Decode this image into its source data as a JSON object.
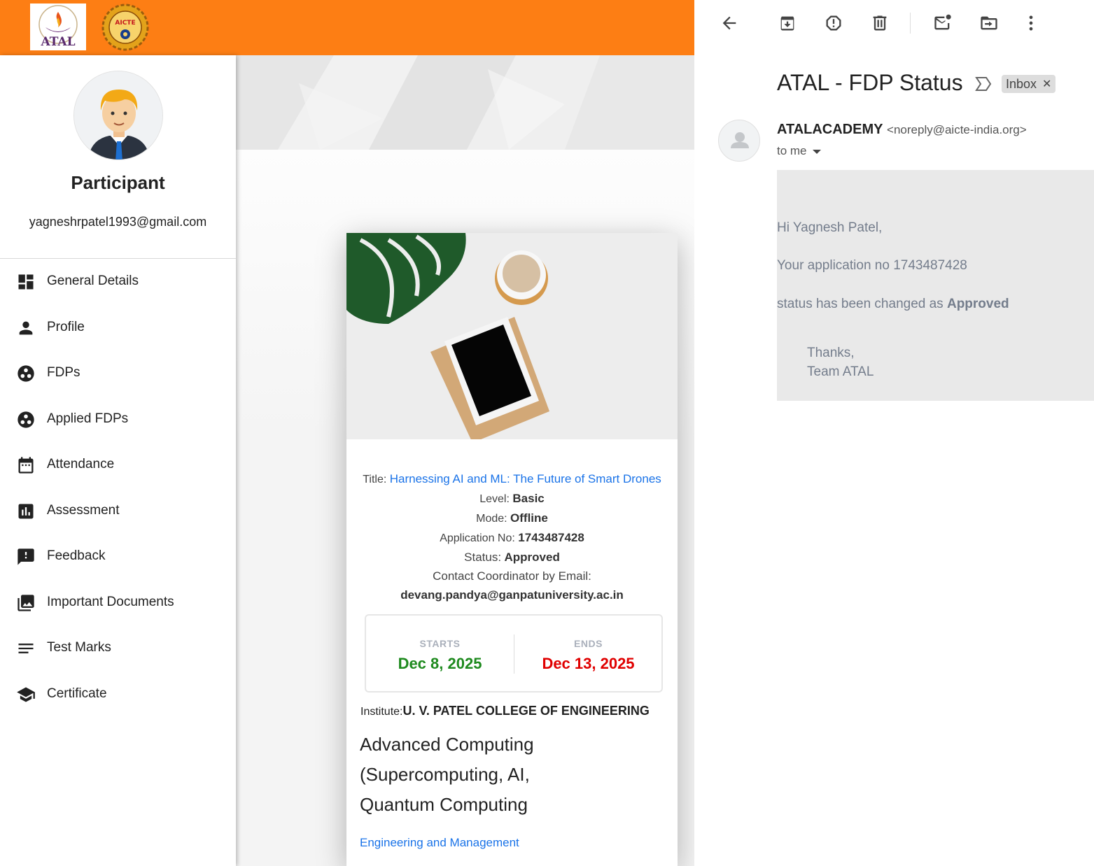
{
  "sidebar": {
    "role": "Participant",
    "email": "yagneshrpatel1993@gmail.com",
    "items": [
      {
        "label": "General Details"
      },
      {
        "label": "Profile"
      },
      {
        "label": "FDPs"
      },
      {
        "label": "Applied FDPs"
      },
      {
        "label": "Attendance"
      },
      {
        "label": "Assessment"
      },
      {
        "label": "Feedback"
      },
      {
        "label": "Important Documents"
      },
      {
        "label": "Test Marks"
      },
      {
        "label": "Certificate"
      }
    ]
  },
  "logos": {
    "atal_text": "ATAL",
    "aicte_text": "AICTE"
  },
  "fdp": {
    "title_label": "Title:",
    "title": "Harnessing AI and ML: The Future of Smart Drones",
    "level_label": "Level:",
    "level": "Basic",
    "mode_label": "Mode:",
    "mode": "Offline",
    "appno_label": "Application No:",
    "appno": "1743487428",
    "status_label": "Status:",
    "status": "Approved",
    "contact_label": "Contact Coordinator by Email:",
    "contact_email": "devang.pandya@ganpatuniversity.ac.in",
    "starts_label": "STARTS",
    "starts": "Dec 8, 2025",
    "ends_label": "ENDS",
    "ends": "Dec 13, 2025",
    "institute_label": "Institute:",
    "institute": "U. V. PATEL COLLEGE OF ENGINEERING",
    "area_lines": [
      "Advanced Computing",
      "(Supercomputing, AI,",
      "Quantum Computing"
    ],
    "category": "Engineering and Management"
  },
  "mail": {
    "subject": "ATAL - FDP Status",
    "label_badge": "Inbox",
    "sender_name": "ATALACADEMY",
    "sender_address": "<noreply@aicte-india.org>",
    "recipient": "to me",
    "greeting": "Hi Yagnesh Patel,",
    "line1": "Your application no 1743487428",
    "line2_prefix": "status has been changed as",
    "line2_status": "Approved",
    "thanks": "Thanks,",
    "team": "Team ATAL"
  },
  "colors": {
    "brand_orange": "#fd7e14",
    "link_blue": "#1a73e8",
    "start_green": "#1e8a1e",
    "end_red": "#e00000"
  }
}
